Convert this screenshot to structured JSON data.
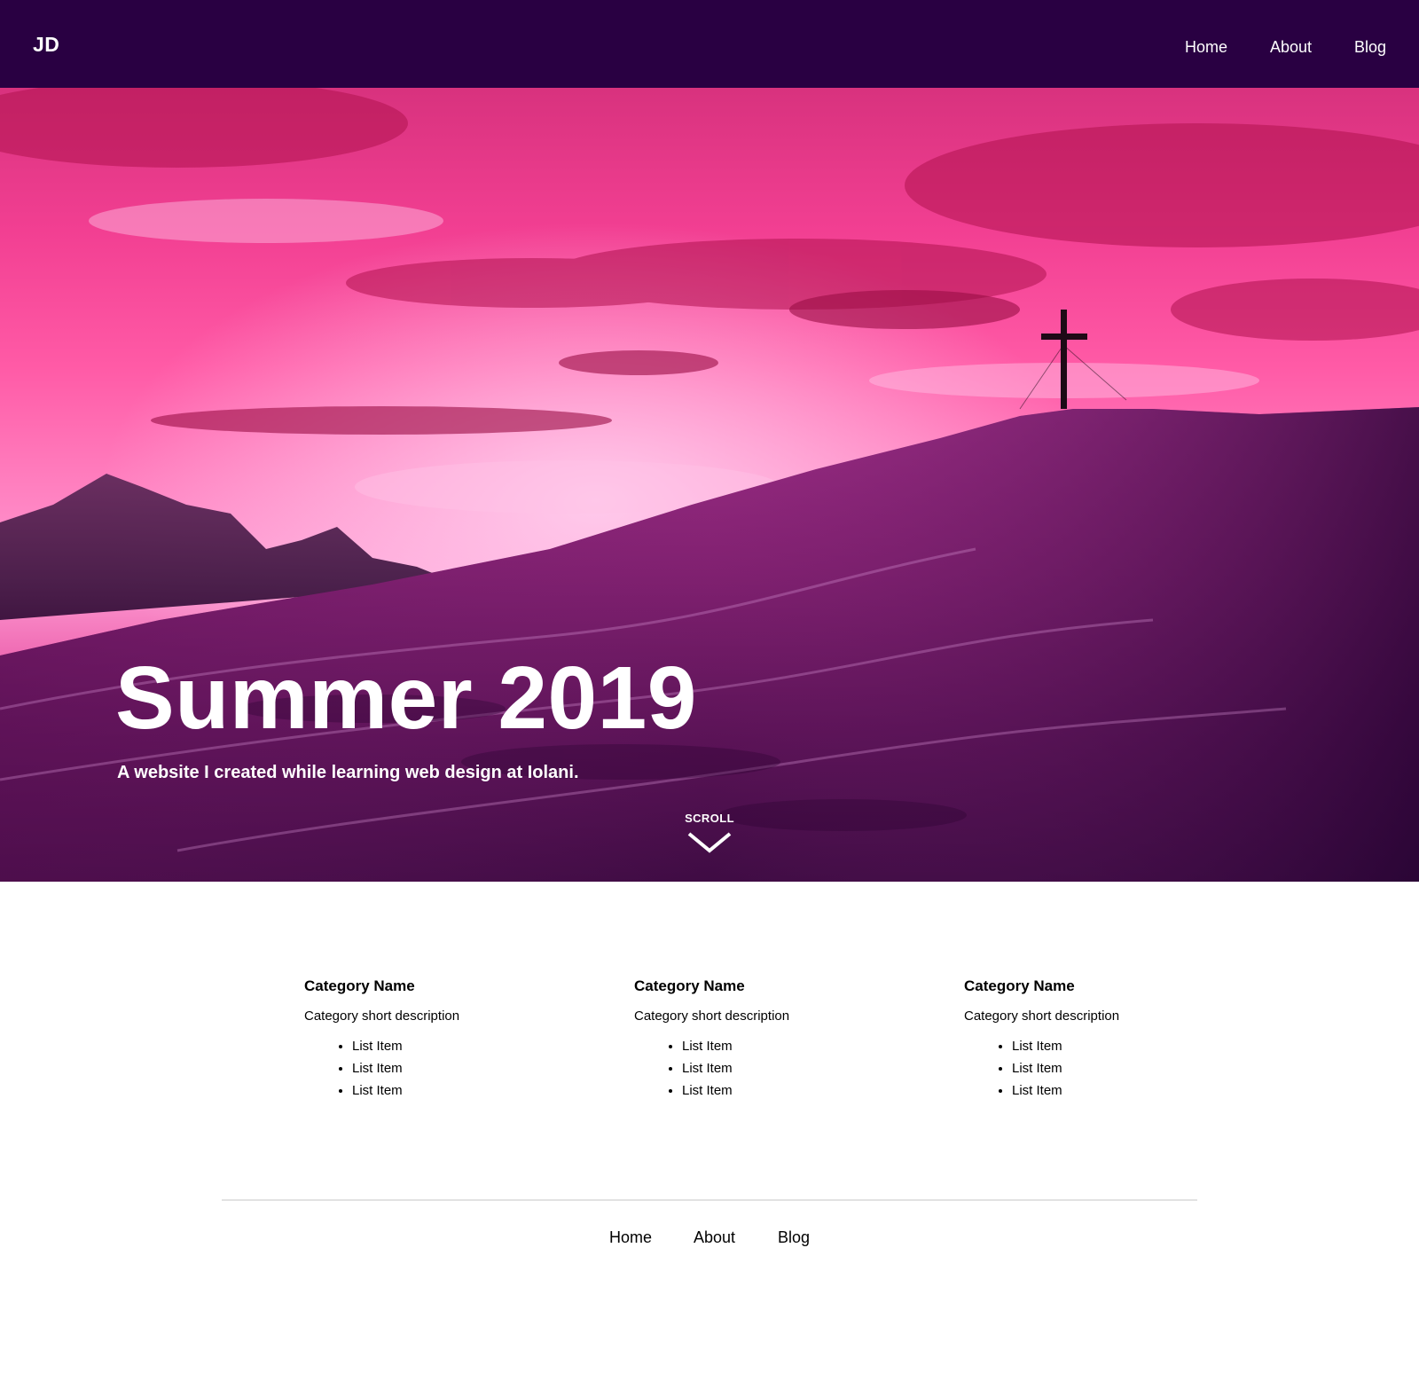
{
  "header": {
    "logo": "JD",
    "background": "#290042",
    "nav": [
      {
        "label": "Home"
      },
      {
        "label": "About"
      },
      {
        "label": "Blog"
      }
    ]
  },
  "hero": {
    "image": "sunset-mountain-with-summit-cross",
    "title": "Summer 2019",
    "subtitle": "A website I created while learning web design at Iolani.",
    "scroll_label": "SCROLL",
    "scroll_icon": "chevron-down-icon"
  },
  "categories": [
    {
      "title": "Category Name",
      "description": "Category short description",
      "items": [
        "List Item",
        "List Item",
        "List Item"
      ]
    },
    {
      "title": "Category Name",
      "description": "Category short description",
      "items": [
        "List Item",
        "List Item",
        "List Item"
      ]
    },
    {
      "title": "Category Name",
      "description": "Category short description",
      "items": [
        "List Item",
        "List Item",
        "List Item"
      ]
    }
  ],
  "footer": {
    "nav": [
      {
        "label": "Home"
      },
      {
        "label": "About"
      },
      {
        "label": "Blog"
      }
    ]
  }
}
